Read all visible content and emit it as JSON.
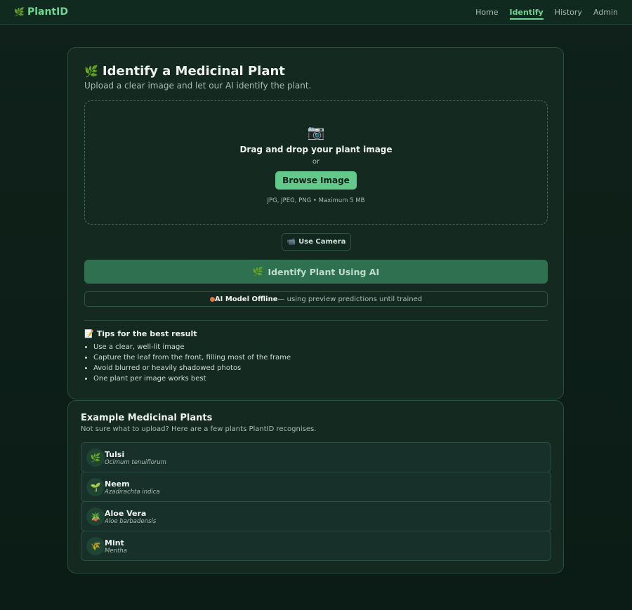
{
  "navbar": {
    "brand": "PlantID",
    "brand_icon": "🌿",
    "links": [
      {
        "label": "Home"
      },
      {
        "label": "Identify",
        "active": true
      },
      {
        "label": "History"
      },
      {
        "label": "Admin"
      }
    ]
  },
  "identify": {
    "title_icon": "🌿",
    "title": "Identify a Medicinal Plant",
    "subtitle": "Upload a clear image and let our AI identify the plant.",
    "dropzone": {
      "icon": "📷",
      "title": "Drag and drop your plant image",
      "or": "or",
      "browse_label": "Browse Image",
      "hint": "JPG, JPEG, PNG • Maximum 5 MB"
    },
    "camera_icon": "📹",
    "camera_label": "Use Camera",
    "identify_icon": "🌿",
    "identify_label": "Identify Plant Using AI",
    "status": {
      "label": "AI Model Offline",
      "text": "— using preview predictions until trained",
      "color": "#e2773b"
    },
    "tips": {
      "icon": "📝",
      "title": "Tips for the best result",
      "items": [
        "Use a clear, well-lit image",
        "Capture the leaf from the front, filling most of the frame",
        "Avoid blurred or heavily shadowed photos",
        "One plant per image works best"
      ]
    }
  },
  "examples": {
    "title": "Example Medicinal Plants",
    "subtitle": "Not sure what to upload? Here are a few plants PlantID recognises.",
    "plants": [
      {
        "icon": "🌿",
        "name": "Tulsi",
        "scientific": "Ocimum tenuiflorum"
      },
      {
        "icon": "🌱",
        "name": "Neem",
        "scientific": "Azadirachta indica"
      },
      {
        "icon": "🪴",
        "name": "Aloe Vera",
        "scientific": "Aloe barbadensis"
      },
      {
        "icon": "🌾",
        "name": "Mint",
        "scientific": "Mentha"
      }
    ]
  },
  "colors": {
    "accent": "#62c98a",
    "background": "#0f211a",
    "card": "#142a21",
    "offline": "#e2773b"
  }
}
